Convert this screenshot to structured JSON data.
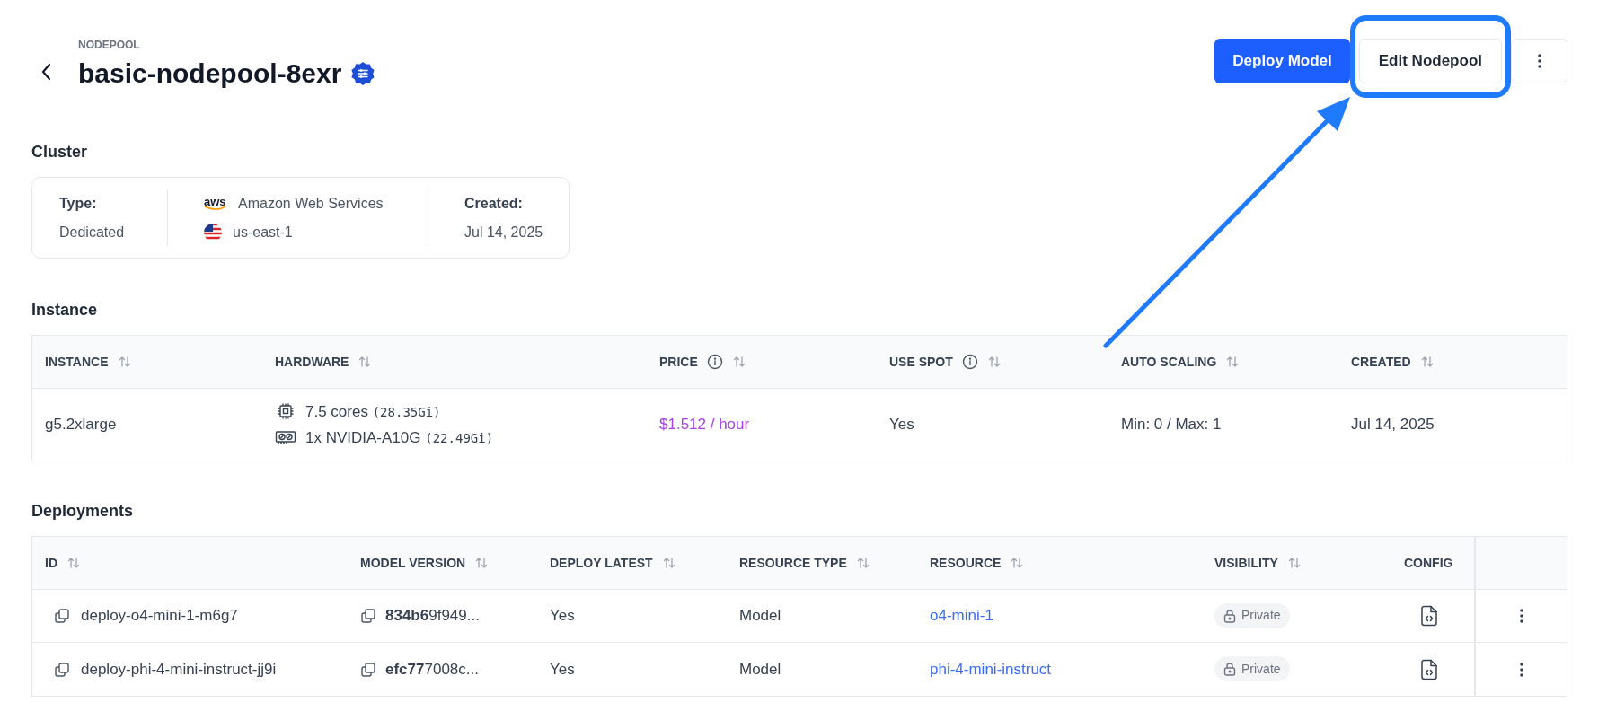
{
  "header": {
    "eyebrow": "NODEPOOL",
    "title": "basic-nodepool-8exr",
    "verified": true,
    "actions": [
      {
        "label": "Deploy Model",
        "kind": "primary",
        "highlighted": false
      },
      {
        "label": "Edit Nodepool",
        "kind": "secondary",
        "highlighted": true
      }
    ]
  },
  "cluster": {
    "heading": "Cluster",
    "type_label": "Type:",
    "type_value": "Dedicated",
    "provider_logo": "aws",
    "provider": "Amazon Web Services",
    "region": "us-east-1",
    "created_label": "Created:",
    "created_value": "Jul 14, 2025"
  },
  "instance": {
    "heading": "Instance",
    "columns": [
      {
        "label": "INSTANCE",
        "info": false
      },
      {
        "label": "HARDWARE",
        "info": false
      },
      {
        "label": "PRICE",
        "info": true
      },
      {
        "label": "USE SPOT",
        "info": true
      },
      {
        "label": "AUTO SCALING",
        "info": false
      },
      {
        "label": "CREATED",
        "info": false
      }
    ],
    "row": {
      "instance": "g5.2xlarge",
      "hardware": [
        {
          "kind": "cpu",
          "text": "7.5 cores",
          "detail": "(28.35Gi)"
        },
        {
          "kind": "gpu",
          "text": "1x NVIDIA-A10G",
          "detail": "(22.49Gi)"
        }
      ],
      "price": "$1.512 / hour",
      "use_spot": "Yes",
      "auto_scaling": "Min: 0 / Max: 1",
      "created": "Jul 14, 2025"
    }
  },
  "deployments": {
    "heading": "Deployments",
    "columns": [
      {
        "label": "ID",
        "sortable": true
      },
      {
        "label": "MODEL VERSION",
        "sortable": true
      },
      {
        "label": "DEPLOY LATEST",
        "sortable": true
      },
      {
        "label": "RESOURCE TYPE",
        "sortable": true
      },
      {
        "label": "RESOURCE",
        "sortable": true
      },
      {
        "label": "VISIBILITY",
        "sortable": true
      },
      {
        "label": "CONFIG",
        "sortable": false
      }
    ],
    "rows": [
      {
        "id": "deploy-o4-mini-1-m6g7",
        "model_version": "**834b6**9f949...",
        "deploy_latest": "Yes",
        "resource_type": "Model",
        "resource": "o4-mini-1",
        "visibility": "Private"
      },
      {
        "id": "deploy-phi-4-mini-instruct-jj9i",
        "model_version": "**efc77**7008c...",
        "deploy_latest": "Yes",
        "resource_type": "Model",
        "resource": "phi-4-mini-instruct",
        "visibility": "Private"
      }
    ]
  }
}
